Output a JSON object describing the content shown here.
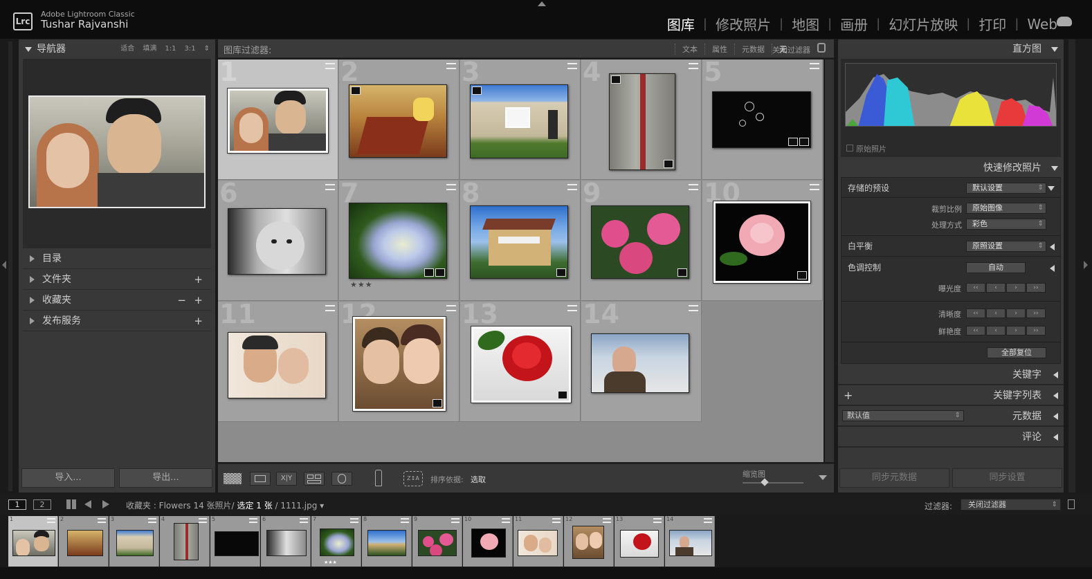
{
  "app": {
    "product": "Adobe Lightroom Classic",
    "user": "Tushar Rajvanshi",
    "logo_text": "Lrc"
  },
  "modules": [
    "图库",
    "修改照片",
    "地图",
    "画册",
    "幻灯片放映",
    "打印",
    "Web"
  ],
  "active_module": "图库",
  "left_panel": {
    "navigator": {
      "title": "导航器",
      "zooms": [
        "适合",
        "填满",
        "1:1",
        "3:1"
      ]
    },
    "sections": [
      {
        "label": "目录",
        "plus": false,
        "minus": false
      },
      {
        "label": "文件夹",
        "plus": true,
        "minus": false
      },
      {
        "label": "收藏夹",
        "plus": true,
        "minus": true
      },
      {
        "label": "发布服务",
        "plus": true,
        "minus": false
      }
    ],
    "import_label": "导入...",
    "export_label": "导出..."
  },
  "filter_bar": {
    "label": "图库过滤器:",
    "tabs": [
      "文本",
      "属性",
      "元数据",
      "无"
    ],
    "active_tab": "无",
    "preset": "关闭过滤器"
  },
  "grid": {
    "cells": [
      {
        "num": "1",
        "selected": true,
        "stars": ""
      },
      {
        "num": "2",
        "selected": false,
        "stars": ""
      },
      {
        "num": "3",
        "selected": false,
        "stars": ""
      },
      {
        "num": "4",
        "selected": false,
        "stars": ""
      },
      {
        "num": "5",
        "selected": false,
        "stars": ""
      },
      {
        "num": "6",
        "selected": false,
        "stars": ""
      },
      {
        "num": "7",
        "selected": false,
        "stars": "★★★"
      },
      {
        "num": "8",
        "selected": false,
        "stars": ""
      },
      {
        "num": "9",
        "selected": false,
        "stars": ""
      },
      {
        "num": "10",
        "selected": false,
        "stars": ""
      },
      {
        "num": "11",
        "selected": false,
        "stars": ""
      },
      {
        "num": "12",
        "selected": false,
        "stars": ""
      },
      {
        "num": "13",
        "selected": false,
        "stars": ""
      },
      {
        "num": "14",
        "selected": false,
        "stars": ""
      }
    ]
  },
  "toolbar": {
    "sort_label": "排序依据:",
    "sort_value": "选取",
    "thumbnail_label": "缩览图"
  },
  "right_panel": {
    "histogram_title": "直方图",
    "original_photo_label": "原始照片",
    "quick_develop": {
      "title": "快速修改照片",
      "saved_preset_label": "存储的预设",
      "saved_preset_value": "默认设置",
      "crop_label": "裁剪比例",
      "crop_value": "原始图像",
      "treatment_label": "处理方式",
      "treatment_value": "彩色",
      "wb_label": "白平衡",
      "wb_value": "原照设置",
      "tone_label": "色调控制",
      "auto_label": "自动",
      "exposure_label": "曝光度",
      "clarity_label": "清晰度",
      "vibrance_label": "鲜艳度",
      "reset_label": "全部复位"
    },
    "keywording": "关键字",
    "keyword_list": "关键字列表",
    "metadata": "元数据",
    "metadata_preset": "默认值",
    "comments": "评论",
    "sync_metadata": "同步元数据",
    "sync_settings": "同步设置"
  },
  "filmstrip_bar": {
    "view1": "1",
    "view2": "2",
    "path_prefix": "收藏夹 : Flowers",
    "count": "14 张照片/",
    "selected": "选定 1 张",
    "file": "/ 1111.jpg",
    "filter_label": "过滤器:",
    "filter_value": "关闭过滤器"
  },
  "filmstrip": {
    "cells": [
      "1",
      "2",
      "3",
      "4",
      "5",
      "6",
      "7",
      "8",
      "9",
      "10",
      "11",
      "12",
      "13",
      "14"
    ],
    "stars_cell": "7",
    "stars": "★★★"
  }
}
